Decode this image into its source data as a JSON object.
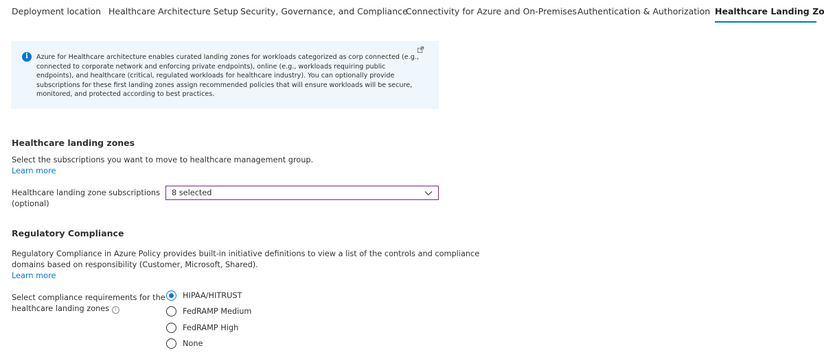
{
  "tabs": [
    {
      "label": "Deployment location",
      "active": false
    },
    {
      "label": "Healthcare Architecture Setup",
      "active": false
    },
    {
      "label": "Security, Governance, and Compliance",
      "active": false
    },
    {
      "label": "Connectivity for Azure and On-Premises",
      "active": false
    },
    {
      "label": "Authentication & Authorization",
      "active": false
    },
    {
      "label": "Healthcare Landing Zones",
      "active": true
    }
  ],
  "info_banner": {
    "text": "Azure for Healthcare architecture enables curated landing zones for workloads categorized as corp connected (e.g., connected to corporate network and enforcing private endpoints), online (e.g., workloads requiring public endpoints), and healthcare (critical, regulated workloads for healthcare industry). You can optionally provide subscriptions for these first landing zones assign recommended policies that will ensure workloads will be secure, monitored, and protected according to best practices.",
    "icon": "info-icon",
    "link_icon": "external-link-icon",
    "color": "#eff6fc"
  },
  "landing_zones": {
    "title": "Healthcare landing zones",
    "description": "Select the subscriptions you want to move to healthcare management group.",
    "learn_more": "Learn more",
    "field_label_line1": "Healthcare landing zone subscriptions",
    "field_label_line2": "(optional)",
    "dropdown_value": "8 selected"
  },
  "compliance": {
    "title": "Regulatory Compliance",
    "description_line1": "Regulatory Compliance in Azure Policy provides built-in initiative definitions to view a list of the controls and compliance",
    "description_line2": "domains based on responsibility (Customer, Microsoft, Shared).",
    "learn_more": "Learn more",
    "field_label_line1": "Select compliance requirements for the",
    "field_label_line2": "healthcare landing zones",
    "options": [
      {
        "label": "HIPAA/HITRUST",
        "checked": true
      },
      {
        "label": "FedRAMP Medium",
        "checked": false
      },
      {
        "label": "FedRAMP High",
        "checked": false
      },
      {
        "label": "None",
        "checked": false
      }
    ]
  },
  "colors": {
    "accent": "#0078d4",
    "dropdown_border": "#6b2d83"
  }
}
